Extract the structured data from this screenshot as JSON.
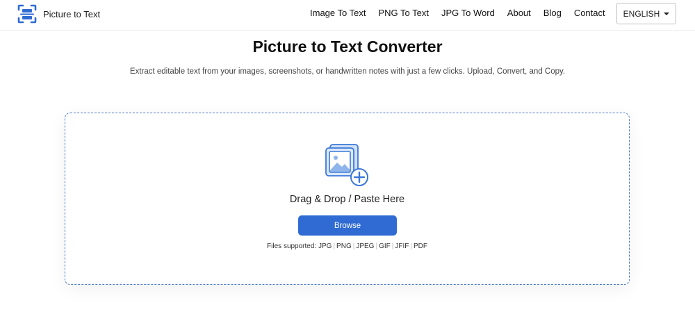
{
  "brand": {
    "name": "Picture to Text",
    "logo_icon": "scan-frame-icon",
    "accent": "#2f6bd2"
  },
  "nav": {
    "links": [
      "Image To Text",
      "PNG To Text",
      "JPG To Word",
      "About",
      "Blog",
      "Contact"
    ],
    "language": "ENGLISH"
  },
  "hero": {
    "title": "Picture to Text Converter",
    "subtitle": "Extract editable text from your images, screenshots, or handwritten notes with just a few clicks. Upload, Convert, and Copy."
  },
  "upload": {
    "icon": "add-image-icon",
    "drop_text": "Drag & Drop / Paste Here",
    "browse_label": "Browse",
    "files_label": "Files supported:",
    "file_types": [
      "JPG",
      "PNG",
      "JPEG",
      "GIF",
      "JFIF",
      "PDF"
    ],
    "border_color": "#4a78c8",
    "button_color": "#2f6bd2"
  }
}
